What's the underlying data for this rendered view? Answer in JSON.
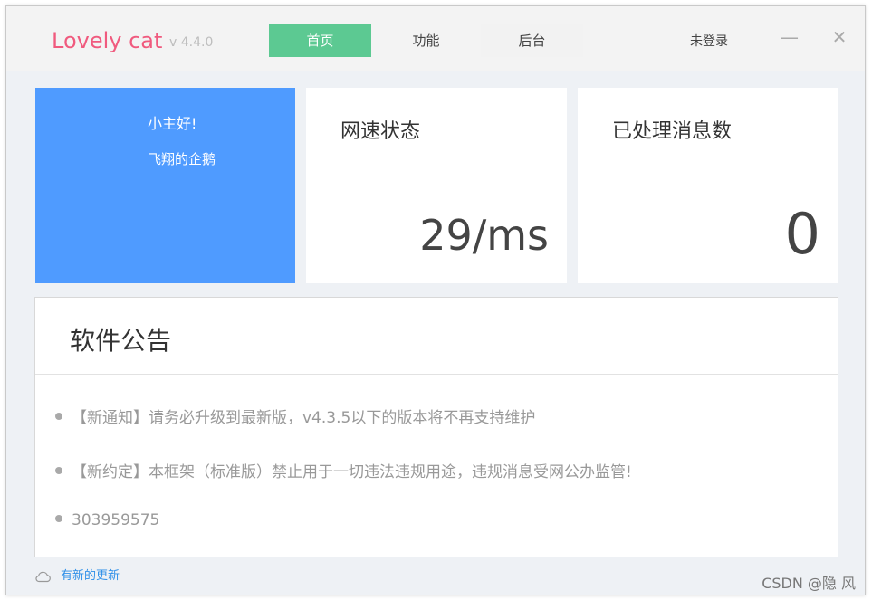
{
  "app": {
    "name": "Lovely cat",
    "version": "v 4.4.0"
  },
  "tabs": [
    {
      "label": "首页",
      "active": true
    },
    {
      "label": "功能",
      "active": false
    },
    {
      "label": "后台",
      "active": false
    }
  ],
  "login": {
    "label": "未登录"
  },
  "window_controls": {
    "minimize": "—",
    "close": "✕"
  },
  "profile_card": {
    "greeting": "小主好!",
    "username": "飞翔的企鹅",
    "color": "#4f9bff"
  },
  "speed_card": {
    "title": "网速状态",
    "value": "29/ms"
  },
  "messages_card": {
    "title": "已处理消息数",
    "value": "0"
  },
  "notice": {
    "title": "软件公告",
    "items": [
      "【新通知】请务必升级到最新版，v4.3.5以下的版本将不再支持维护",
      "【新约定】本框架（标准版）禁止用于一切违法违规用途，违规消息受网公办监管!",
      "303959575"
    ]
  },
  "update": {
    "label": "有新的更新",
    "icon": "cloud-icon"
  },
  "watermark": "CSDN @隐 风",
  "colors": {
    "accent_green": "#5cc992",
    "brand_pink": "#f05a7e",
    "link_blue": "#2e8fe8"
  }
}
